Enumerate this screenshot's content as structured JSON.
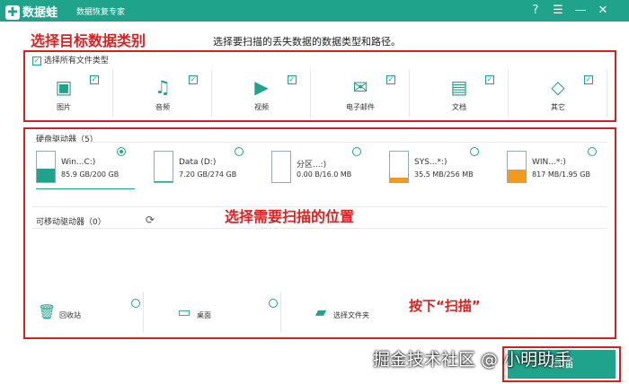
{
  "app": {
    "name": "数据蛙",
    "subtitle": "数据恢复专家"
  },
  "window_controls": {
    "help": "?",
    "menu": "☰",
    "minimize": "—",
    "close": "✕"
  },
  "instruction": "选择要扫描的丢失数据的数据类型和路径。",
  "annotations": {
    "select_type": "选择目标数据类别",
    "select_location": "选择需要扫描的位置",
    "press_scan": "按下“扫描”"
  },
  "file_types": {
    "select_all_label": "选择所有文件类型",
    "items": [
      {
        "label": "图片",
        "icon": "image-icon",
        "glyph": "▣",
        "checked": true
      },
      {
        "label": "音频",
        "icon": "music-icon",
        "glyph": "♫",
        "checked": true
      },
      {
        "label": "视频",
        "icon": "video-icon",
        "glyph": "▶",
        "checked": true
      },
      {
        "label": "电子邮件",
        "icon": "mail-icon",
        "glyph": "✉",
        "checked": true
      },
      {
        "label": "文档",
        "icon": "document-icon",
        "glyph": "▤",
        "checked": true
      },
      {
        "label": "其它",
        "icon": "other-icon",
        "glyph": "◇",
        "checked": true
      }
    ]
  },
  "hard_drives": {
    "label": "硬盘驱动器（5）",
    "items": [
      {
        "name": "Win...C:)",
        "size": "85.9 GB/200 GB",
        "used_fraction": 0.43,
        "fill_color": "#1fa38a",
        "selected": true
      },
      {
        "name": "Data (D:)",
        "size": "7.20 GB/274 GB",
        "used_fraction": 0.03,
        "fill_color": "#1fa38a",
        "selected": false
      },
      {
        "name": "分区...:)",
        "size": "0.00  B/16.0 MB",
        "used_fraction": 0.0,
        "fill_color": "#f39a1e",
        "selected": false
      },
      {
        "name": "SYS...*:)",
        "size": "35.5 MB/256 MB",
        "used_fraction": 0.14,
        "fill_color": "#f39a1e",
        "selected": false
      },
      {
        "name": "WIN...*:)",
        "size": "817 MB/1.95 GB",
        "used_fraction": 0.42,
        "fill_color": "#f39a1e",
        "selected": false
      }
    ]
  },
  "removable_drives": {
    "label": "可移动驱动器（0）"
  },
  "locations": [
    {
      "label": "回收站",
      "icon": "recycle-bin-icon",
      "glyph": "🗑"
    },
    {
      "label": "桌面",
      "icon": "desktop-icon",
      "glyph": "▭"
    },
    {
      "label": "选择文件夹",
      "icon": "folder-icon",
      "glyph": "▰"
    }
  ],
  "scan_button": {
    "label": "扫描"
  },
  "watermark": "掘金技术社区 @ 小明助手",
  "colors": {
    "accent": "#1fa38a",
    "annotation": "#e02020",
    "warning_fill": "#f39a1e"
  }
}
